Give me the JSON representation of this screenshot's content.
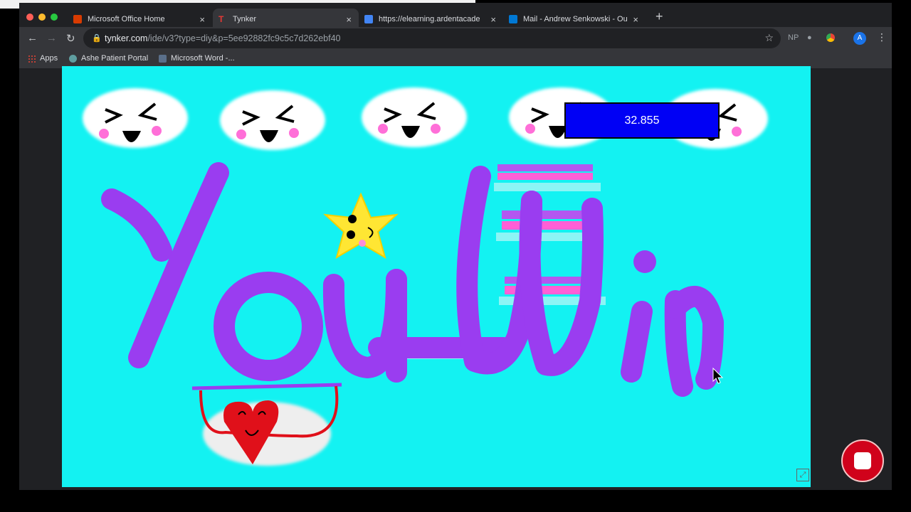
{
  "browser": {
    "tabs": [
      {
        "title": "Microsoft Office Home",
        "fav_color": "#d83b01",
        "active": false
      },
      {
        "title": "Tynker",
        "fav_color": "#e53935",
        "active": true
      },
      {
        "title": "https://elearning.ardentacade",
        "fav_color": "#4285f4",
        "active": false
      },
      {
        "title": "Mail - Andrew Senkowski - Ou",
        "fav_color": "#0078d4",
        "active": false
      }
    ],
    "new_tab_symbol": "+",
    "close_symbol": "×",
    "address": {
      "host": "tynker.com",
      "path": "/ide/v3?type=diy&p=5ee92882fc9c5c7d262ebf40"
    },
    "bookmarks": [
      {
        "label": "Apps",
        "icon": "apps-grid-icon"
      },
      {
        "label": "Ashe Patient Portal",
        "icon": "globe-icon"
      },
      {
        "label": "Microsoft Word -...",
        "icon": "word-icon"
      }
    ],
    "extensions": [
      "NP"
    ],
    "profile_initial": "A"
  },
  "game": {
    "score": "32.855",
    "background": "#13f2f2",
    "text_color": "#9a3df0"
  },
  "colors": {
    "record": "#d0021b",
    "score_box": "#0000f5"
  }
}
